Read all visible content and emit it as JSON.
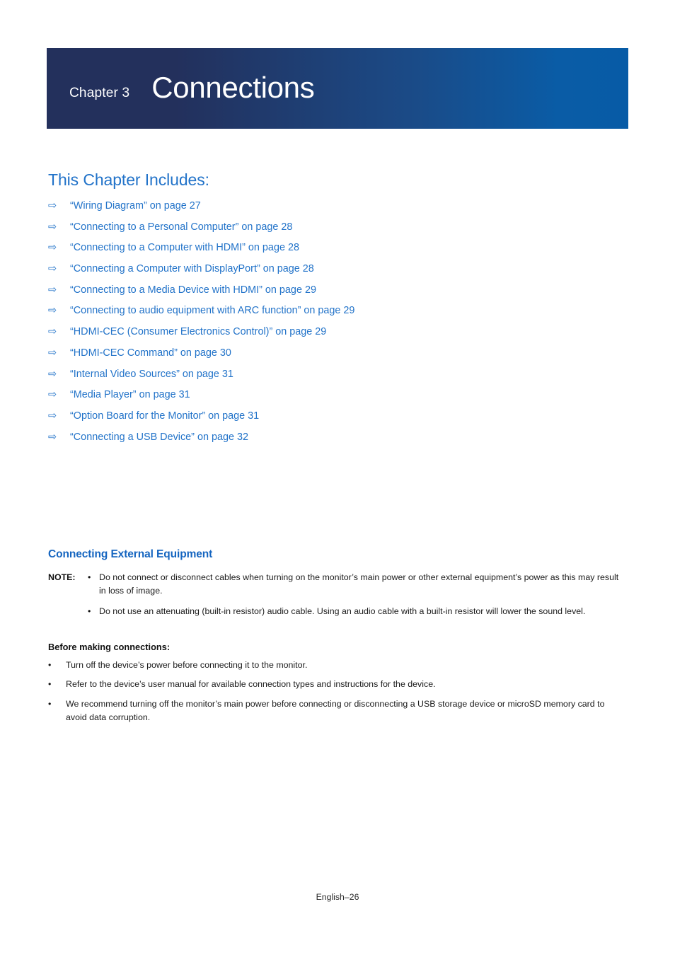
{
  "banner": {
    "chapter_label": "Chapter 3",
    "title": "Connections",
    "gradient_start": "#23305c",
    "gradient_end": "#075ba6"
  },
  "includes": {
    "heading": "This Chapter Includes:",
    "arrow_glyph": "⇨",
    "link_color": "#2273c9",
    "items": [
      {
        "label": "“Wiring Diagram” on page 27"
      },
      {
        "label": "“Connecting to a Personal Computer” on page 28"
      },
      {
        "label": "“Connecting to a Computer with HDMI” on page 28"
      },
      {
        "label": "“Connecting a Computer with DisplayPort” on page 28"
      },
      {
        "label": "“Connecting to a Media Device with HDMI” on page 29"
      },
      {
        "label": "“Connecting to audio equipment with ARC function” on page 29"
      },
      {
        "label": "“HDMI-CEC (Consumer Electronics Control)” on page 29"
      },
      {
        "label": "“HDMI-CEC Command” on page 30"
      },
      {
        "label": "“Internal Video Sources” on page 31"
      },
      {
        "label": "“Media Player” on page 31"
      },
      {
        "label": "“Option Board for the Monitor” on page 31"
      },
      {
        "label": "“Connecting a USB Device” on page 32"
      }
    ]
  },
  "external_equipment": {
    "heading": "Connecting External Equipment",
    "heading_color": "#1565c0",
    "note_label": "NOTE:",
    "bullet_glyph": "•",
    "notes": [
      "Do not connect or disconnect cables when turning on the monitor’s main power or other external equipment’s power as this may result in loss of image.",
      "Do not use an attenuating (built-in resistor) audio cable. Using an audio cable with a built-in resistor will lower the sound level."
    ]
  },
  "before_connections": {
    "heading": "Before making connections:",
    "bullet_glyph": "•",
    "items": [
      "Turn off the device’s power before connecting it to the monitor.",
      "Refer to the device’s user manual for available connection types and instructions for the device.",
      "We recommend turning off the monitor’s main power before connecting or disconnecting a USB storage device or microSD memory card to avoid data corruption."
    ]
  },
  "footer": {
    "text": "English–26"
  }
}
